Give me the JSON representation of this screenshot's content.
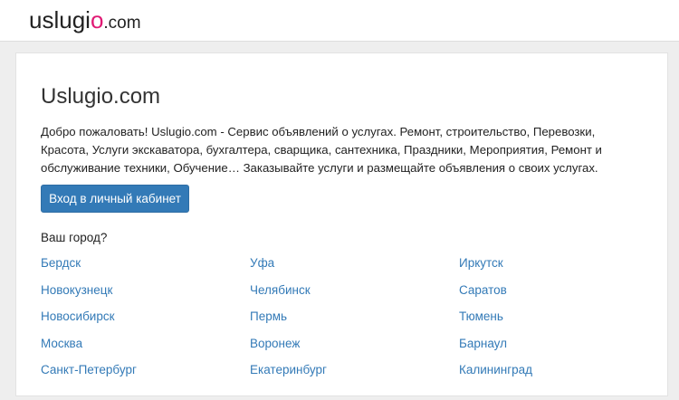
{
  "header": {
    "logo_main": "uslugi",
    "logo_accent": "o",
    "logo_tld": ".com"
  },
  "main": {
    "title": "Uslugio.com",
    "intro": "Добро пожаловать! Uslugio.com - Сервис объявлений о услугах. Ремонт, строительство, Перевозки, Красота, Услуги экскаватора, бухгалтера, сварщика, сантехника, Праздники, Мероприятия, Ремонт и обслуживание техники, Обучение… Заказывайте услуги и размещайте объявления о своих услугах.",
    "login_button": "Вход в личный кабинет",
    "city_prompt": "Ваш город?",
    "cities": [
      [
        "Бердск",
        "Уфа",
        "Иркутск"
      ],
      [
        "Новокузнецк",
        "Челябинск",
        "Саратов"
      ],
      [
        "Новосибирск",
        "Пермь",
        "Тюмень"
      ],
      [
        "Москва",
        "Воронеж",
        "Барнаул"
      ],
      [
        "Санкт-Петербург",
        "Екатеринбург",
        "Калининград"
      ]
    ]
  },
  "colors": {
    "accent": "#e01a74",
    "link": "#337ab7",
    "button": "#337ab7"
  }
}
